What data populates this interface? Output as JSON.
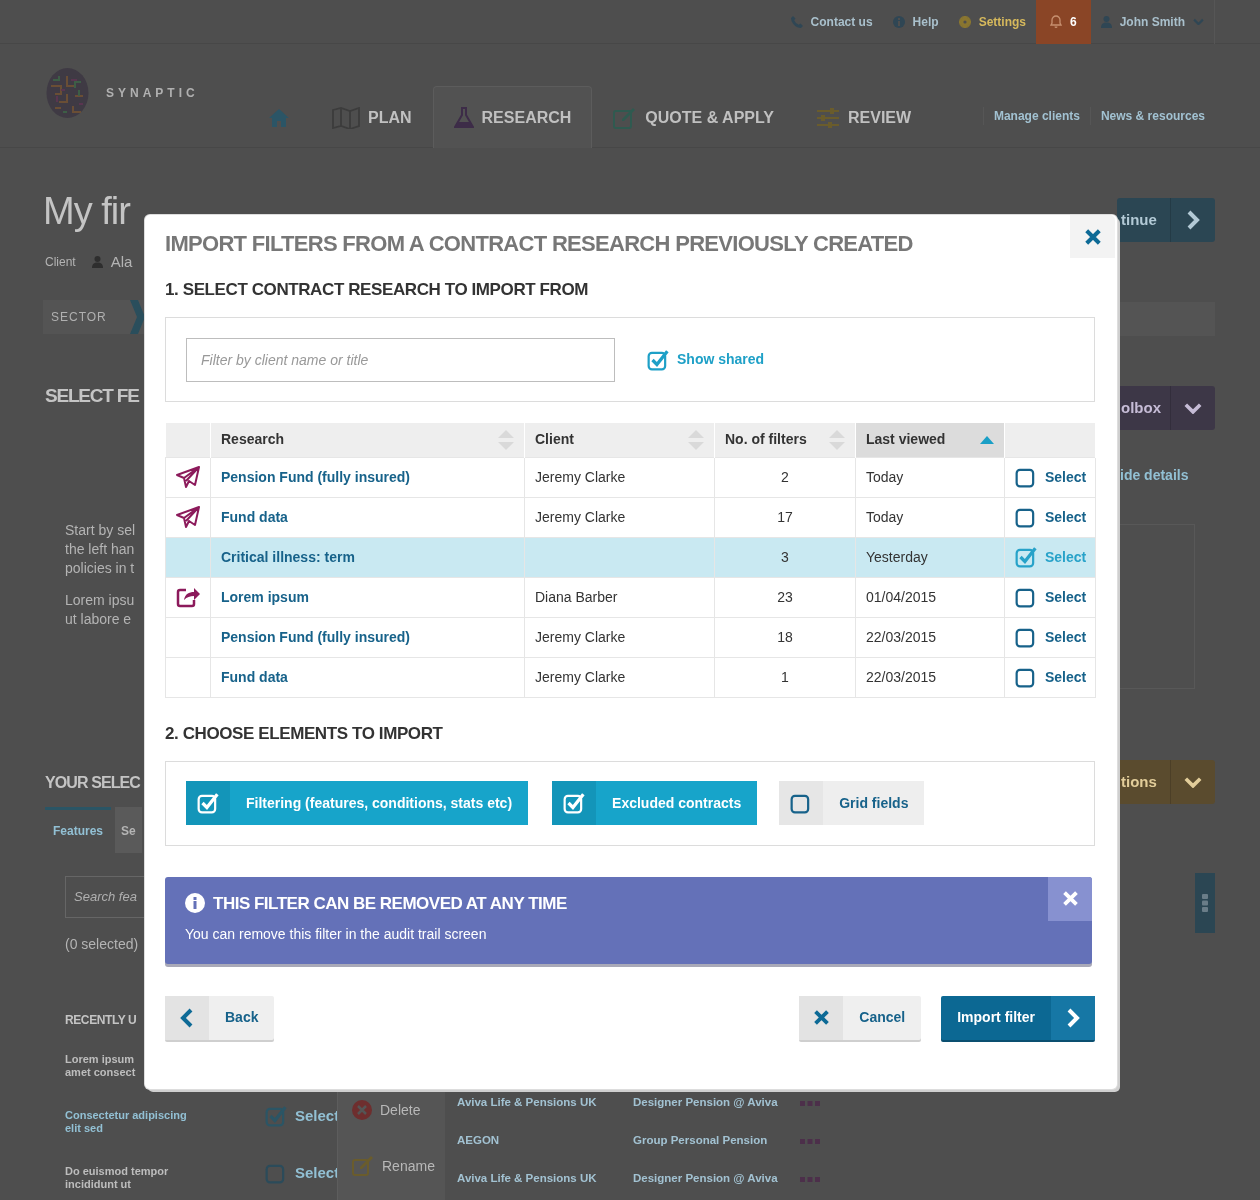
{
  "top_bar": {
    "links": [
      {
        "kind": "phone",
        "label": "Contact us"
      },
      {
        "kind": "help",
        "label": "Help"
      },
      {
        "kind": "settings",
        "label": "Settings"
      }
    ],
    "notifications": {
      "count": "6"
    },
    "user": {
      "name": "John Smith"
    }
  },
  "header": {
    "logo": "SYNAPTIC",
    "tabs": [
      {
        "kind": "home",
        "selected": false
      },
      {
        "kind": "plan",
        "label": "PLAN",
        "selected": false
      },
      {
        "kind": "research",
        "label": "RESEARCH",
        "selected": true
      },
      {
        "kind": "quote",
        "label": "QUOTE & APPLY",
        "selected": false
      },
      {
        "kind": "review",
        "label": "REVIEW",
        "selected": false
      }
    ],
    "links": [
      "Manage clients",
      "News & resources"
    ]
  },
  "page": {
    "title": "My fir",
    "client_label": "Client",
    "client_name": "Ala",
    "sector_label": "SECTOR",
    "section_heading": "SELECT FE",
    "intro_lines": [
      "Start by sel",
      "the left han",
      "policies in t"
    ],
    "note_lines": [
      "Lorem ipsu",
      "ut labore e"
    ],
    "selection_heading": "YOUR SELEC",
    "selection_tabs": [
      {
        "label": "Features",
        "selected": true
      },
      {
        "label": "Se",
        "selected": false
      }
    ],
    "search": {
      "placeholder": "Search fea"
    },
    "selected_count": "(0 selected)",
    "recent_heading": "RECENTLY U",
    "recent_items": [
      {
        "kind": "plain",
        "lines": [
          "Lorem ipsum",
          "amet consect"
        ]
      },
      {
        "kind": "link",
        "lines": [
          "Consectetur adipiscing",
          "elit sed"
        ],
        "select_label": "Select",
        "checked": true
      },
      {
        "kind": "plain",
        "lines": [
          "Do euismod tempor",
          "incididunt ut"
        ],
        "select_label": "Select",
        "checked": false
      }
    ],
    "menu": [
      {
        "kind": "delete",
        "label": "Delete"
      },
      {
        "kind": "rename",
        "label": "Rename"
      }
    ],
    "results": [
      {
        "provider": "Aviva Life & Pensions UK",
        "product": "Designer Pension @ Aviva"
      },
      {
        "provider": "AEGON",
        "product": "Group Personal Pension"
      },
      {
        "provider": "Aviva Life & Pensions UK",
        "product": "Designer Pension @ Aviva"
      }
    ],
    "continue_button": "tinue",
    "toolbox_button": "olbox",
    "details_link": "ide details",
    "options_button": "tions"
  },
  "modal": {
    "title": "IMPORT FILTERS FROM A CONTRACT RESEARCH PREVIOUSLY CREATED",
    "step1": "1. SELECT CONTRACT RESEARCH TO IMPORT FROM",
    "filter": {
      "placeholder": "Filter by client name or title"
    },
    "show_shared": {
      "label": "Show shared",
      "checked": true
    },
    "columns": [
      {
        "label": "Research",
        "sorted": false
      },
      {
        "label": "Client",
        "sorted": false
      },
      {
        "label": "No. of filters",
        "sorted": false
      },
      {
        "label": "Last viewed",
        "sorted": true
      }
    ],
    "rows": [
      {
        "kind": "sent",
        "research": "Pension Fund (fully insured)",
        "client": "Jeremy Clarke",
        "filters": "2",
        "last_viewed": "Today",
        "select_label": "Select",
        "selected": false
      },
      {
        "kind": "sent",
        "research": "Fund data",
        "client": "Jeremy Clarke",
        "filters": "17",
        "last_viewed": "Today",
        "select_label": "Select",
        "selected": false
      },
      {
        "kind": "plain",
        "research": "Critical illness: term",
        "filters": "3",
        "last_viewed": "Yesterday",
        "select_label": "Select",
        "selected": true
      },
      {
        "kind": "shared",
        "research": "Lorem ipsum",
        "client": "Diana Barber",
        "filters": "23",
        "last_viewed": "01/04/2015",
        "select_label": "Select",
        "selected": false
      },
      {
        "kind": "plain",
        "research": "Pension Fund (fully insured)",
        "client": "Jeremy Clarke",
        "filters": "18",
        "last_viewed": "22/03/2015",
        "select_label": "Select",
        "selected": false
      },
      {
        "kind": "plain",
        "research": "Fund data",
        "client": "Jeremy Clarke",
        "filters": "1",
        "last_viewed": "22/03/2015",
        "select_label": "Select",
        "selected": false
      }
    ],
    "step2": "2. CHOOSE ELEMENTS TO IMPORT",
    "elements": [
      {
        "label": "Filtering (features, conditions, stats etc)",
        "checked": true
      },
      {
        "label": "Excluded contracts",
        "checked": true
      },
      {
        "label": "Grid fields",
        "checked": false
      }
    ],
    "alert": {
      "title": "THIS FILTER CAN BE REMOVED AT ANY TIME",
      "text": "You can remove this filter in the audit trail screen"
    },
    "buttons": [
      {
        "kind": "back",
        "label": "Back"
      },
      {
        "kind": "cancel",
        "label": "Cancel"
      },
      {
        "kind": "import",
        "label": "Import filter"
      }
    ]
  }
}
